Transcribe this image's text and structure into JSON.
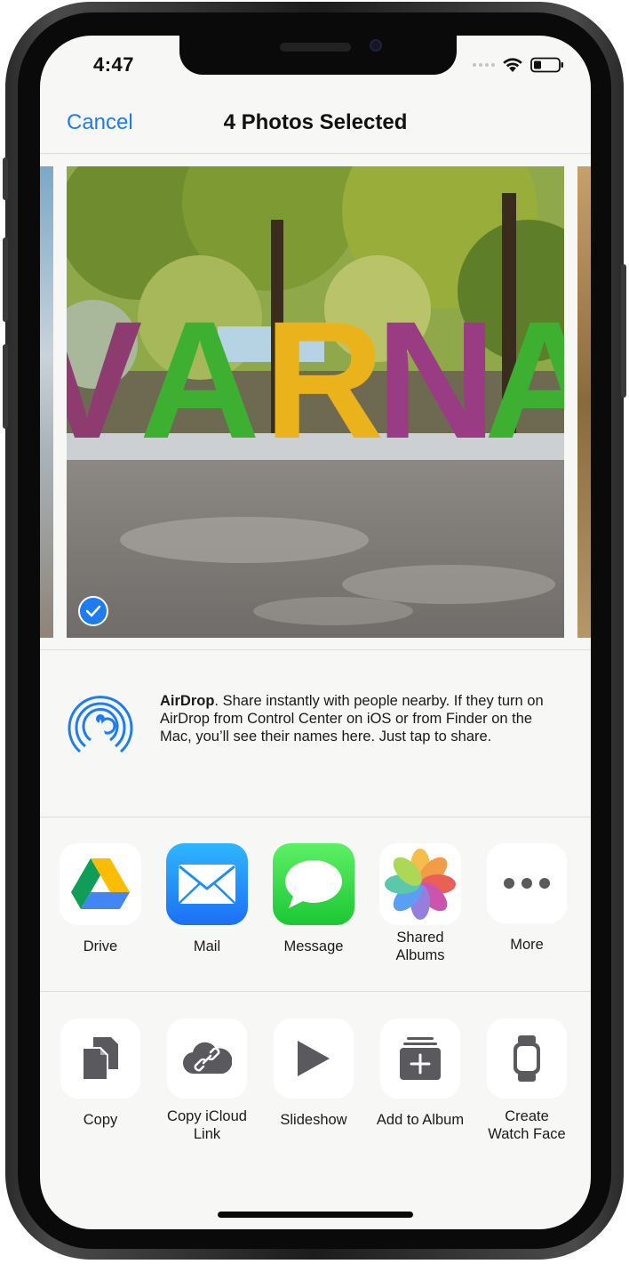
{
  "status_bar": {
    "time": "4:47"
  },
  "nav": {
    "cancel_label": "Cancel",
    "title": "4 Photos Selected"
  },
  "photo": {
    "sign_letters": [
      "V",
      "A",
      "R",
      "N",
      "A"
    ]
  },
  "airdrop": {
    "title": "AirDrop",
    "description": ". Share instantly with people nearby. If they turn on AirDrop from Control Center on iOS or from Finder on the Mac, you’ll see their names here. Just tap to share."
  },
  "apps": [
    {
      "label": "Drive",
      "icon": "google-drive-icon"
    },
    {
      "label": "Mail",
      "icon": "mail-icon"
    },
    {
      "label": "Message",
      "icon": "messages-icon"
    },
    {
      "label": "Shared Albums",
      "icon": "photos-icon"
    },
    {
      "label": "More",
      "icon": "more-icon"
    }
  ],
  "actions": [
    {
      "label": "Copy",
      "icon": "copy-icon"
    },
    {
      "label": "Copy iCloud Link",
      "icon": "icloud-link-icon"
    },
    {
      "label": "Slideshow",
      "icon": "play-icon"
    },
    {
      "label": "Add to Album",
      "icon": "add-to-album-icon"
    },
    {
      "label": "Create Watch Face",
      "icon": "watch-icon"
    }
  ],
  "colors": {
    "accent": "#1e7cf2",
    "sheet_background": "#f7f7f5",
    "icon_gray": "#5a5a5e"
  }
}
